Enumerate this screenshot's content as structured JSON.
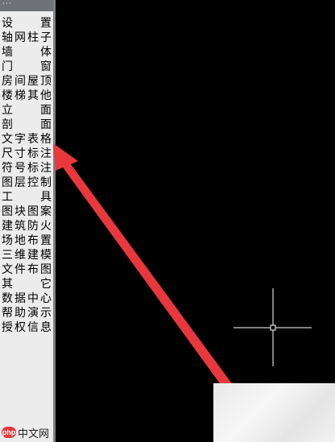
{
  "panel": {
    "title": "···",
    "items": [
      {
        "label": "设置",
        "chars": [
          "设",
          "置"
        ]
      },
      {
        "label": "轴网柱子",
        "chars": [
          "轴",
          "网",
          "柱",
          "子"
        ]
      },
      {
        "label": "墙体",
        "chars": [
          "墙",
          "体"
        ]
      },
      {
        "label": "门窗",
        "chars": [
          "门",
          "窗"
        ]
      },
      {
        "label": "房间屋顶",
        "chars": [
          "房",
          "间",
          "屋",
          "顶"
        ]
      },
      {
        "label": "楼梯其他",
        "chars": [
          "楼",
          "梯",
          "其",
          "他"
        ]
      },
      {
        "label": "立面",
        "chars": [
          "立",
          "面"
        ]
      },
      {
        "label": "剖面",
        "chars": [
          "剖",
          "面"
        ]
      },
      {
        "label": "文字表格",
        "chars": [
          "文",
          "字",
          "表",
          "格"
        ]
      },
      {
        "label": "尺寸标注",
        "chars": [
          "尺",
          "寸",
          "标",
          "注"
        ]
      },
      {
        "label": "符号标注",
        "chars": [
          "符",
          "号",
          "标",
          "注"
        ]
      },
      {
        "label": "图层控制",
        "chars": [
          "图",
          "层",
          "控",
          "制"
        ]
      },
      {
        "label": "工具",
        "chars": [
          "工",
          "具"
        ]
      },
      {
        "label": "图块图案",
        "chars": [
          "图",
          "块",
          "图",
          "案"
        ]
      },
      {
        "label": "建筑防火",
        "chars": [
          "建",
          "筑",
          "防",
          "火"
        ]
      },
      {
        "label": "场地布置",
        "chars": [
          "场",
          "地",
          "布",
          "置"
        ]
      },
      {
        "label": "三维建模",
        "chars": [
          "三",
          "维",
          "建",
          "模"
        ]
      },
      {
        "label": "文件布图",
        "chars": [
          "文",
          "件",
          "布",
          "图"
        ]
      },
      {
        "label": "其它",
        "chars": [
          "其",
          "它"
        ]
      },
      {
        "label": "数据中心",
        "chars": [
          "数",
          "据",
          "中",
          "心"
        ]
      },
      {
        "label": "帮助演示",
        "chars": [
          "帮",
          "助",
          "演",
          "示"
        ]
      },
      {
        "label": "授权信息",
        "chars": [
          "授",
          "权",
          "信",
          "息"
        ]
      }
    ]
  },
  "watermark": {
    "badge": "php",
    "text": "中文网"
  },
  "colors": {
    "annotation_arrow": "#e8383d",
    "crosshair": "#ffffff",
    "canvas": "#000000"
  }
}
